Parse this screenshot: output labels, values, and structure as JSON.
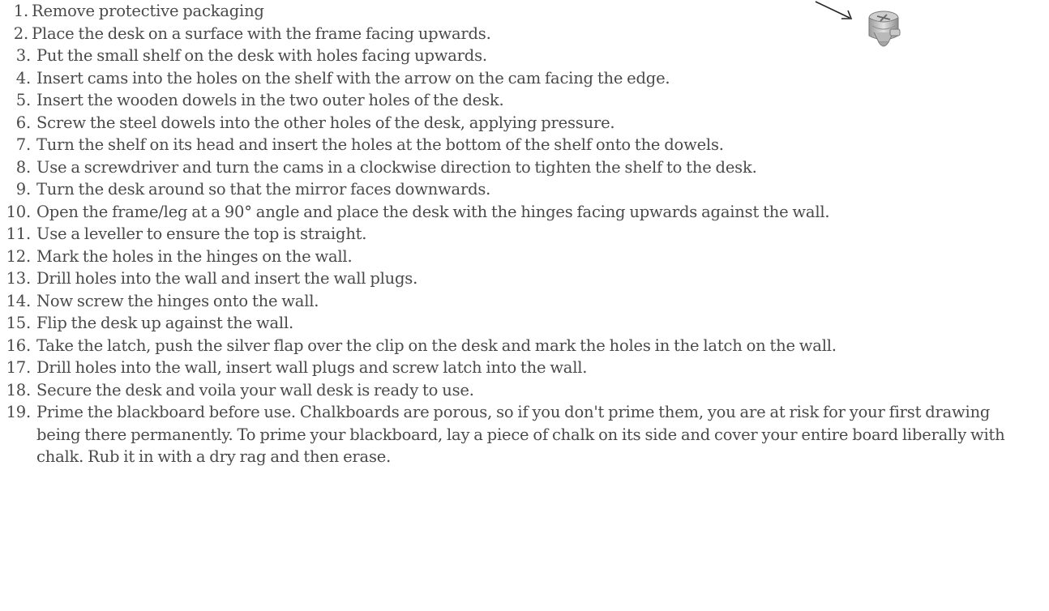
{
  "steps": [
    {
      "num": "1.",
      "text": "Remove protective packaging"
    },
    {
      "num": "2.",
      "text": "Place the desk on a surface with the frame facing upwards."
    },
    {
      "num": "3.",
      "text": "Put the small shelf on the desk with holes facing upwards."
    },
    {
      "num": "4.",
      "text": "Insert cams into the holes on the shelf with the arrow on the cam facing the edge."
    },
    {
      "num": "5.",
      "text": "Insert the wooden dowels in the two outer holes of the desk."
    },
    {
      "num": "6.",
      "text": "Screw the steel dowels into the other holes of the desk, applying pressure."
    },
    {
      "num": "7.",
      "text": "Turn the shelf on its head and insert the holes at the bottom of the shelf onto the dowels."
    },
    {
      "num": "8.",
      "text": "Use a screwdriver and turn the cams in a clockwise direction to tighten the shelf to the desk."
    },
    {
      "num": "9.",
      "text": "Turn the desk around so that the mirror faces downwards."
    },
    {
      "num": "10.",
      "text": "Open the frame/leg at a 90° angle and place the desk with the hinges facing upwards against the wall."
    },
    {
      "num": "11.",
      "text": "Use a leveller to ensure the top is straight."
    },
    {
      "num": "12.",
      "text": "Mark the holes in the hinges on the wall."
    },
    {
      "num": "13.",
      "text": "Drill holes into the wall and insert the wall plugs."
    },
    {
      "num": "14.",
      "text": "Now screw the hinges onto the wall."
    },
    {
      "num": "15.",
      "text": "Flip the desk up against the wall."
    },
    {
      "num": "16.",
      "text": "Take the latch, push the silver flap over the clip on the desk and mark the holes in the latch on the wall."
    },
    {
      "num": "17.",
      "text": "Drill holes into the wall, insert wall plugs and screw latch into the wall."
    },
    {
      "num": "18.",
      "text": "Secure the desk and voila your wall desk is ready to use."
    },
    {
      "num": "19.",
      "text": "Prime the blackboard before use. Chalkboards are porous, so if you don't prime them, you are at risk for your first drawing being there permanently. To prime your blackboard, lay a piece of chalk on its side and cover your entire board liberally with chalk. Rub it in with a dry rag and then erase."
    }
  ],
  "illustration": {
    "icon": "cam-lock-fitting-icon",
    "pointer": "arrow-icon"
  }
}
